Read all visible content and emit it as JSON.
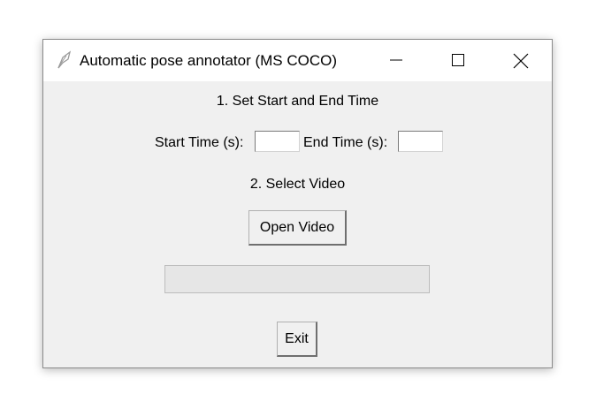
{
  "window": {
    "title": "Automatic pose annotator (MS COCO)"
  },
  "form": {
    "step1_label": "1. Set Start and End Time",
    "start_time_label": "Start Time (s):",
    "start_time_value": "",
    "end_time_label": "End Time (s):",
    "end_time_value": "",
    "step2_label": "2. Select Video",
    "open_video_label": "Open Video",
    "progress_fraction": 0,
    "exit_label": "Exit"
  },
  "icons": {
    "app": "feather-icon",
    "minimize": "minimize-icon",
    "maximize": "maximize-icon",
    "close": "close-icon"
  }
}
